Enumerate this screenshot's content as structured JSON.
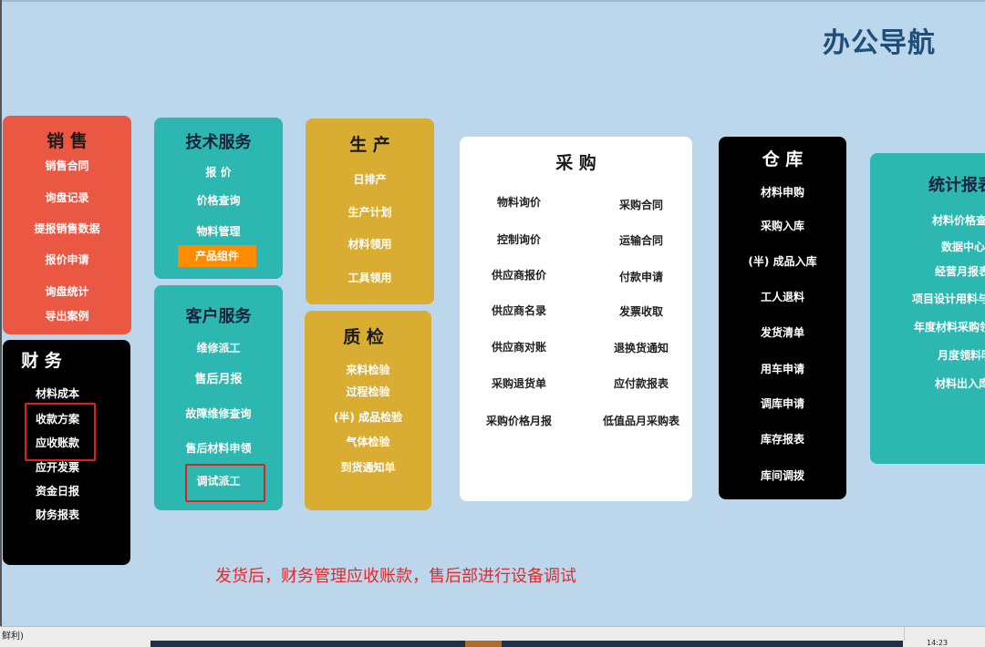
{
  "page_title": "办公导航",
  "sales": {
    "title": "销 售",
    "items": [
      "销售合同",
      "询盘记录",
      "提报销售数据",
      "报价申请",
      "询盘统计",
      "导出案例"
    ]
  },
  "finance": {
    "title": "财 务",
    "items": [
      "材料成本",
      "收款方案",
      "应收账款",
      "应开发票",
      "资金日报",
      "财务报表"
    ]
  },
  "tech_service": {
    "title": "技术服务",
    "items": [
      "报 价",
      "价格查询",
      "物料管理",
      "产品组件"
    ]
  },
  "customer_service": {
    "title": "客户服务",
    "items": [
      "维修派工",
      "售后月报",
      "故障维修查询",
      "售后材料申领",
      "调试派工"
    ]
  },
  "production": {
    "title": "生 产",
    "items": [
      "日排产",
      "生产计划",
      "材料领用",
      "工具领用"
    ]
  },
  "quality": {
    "title": "质 检",
    "items": [
      "来料检验",
      "过程检验",
      "(半) 成品检验",
      "气体检验",
      "到货通知单"
    ]
  },
  "purchase": {
    "title": "采 购",
    "left": [
      "物料询价",
      "控制询价",
      "供应商报价",
      "供应商名录",
      "供应商对账",
      "采购退货单",
      "采购价格月报"
    ],
    "right": [
      "采购合同",
      "运输合同",
      "付款申请",
      "发票收取",
      "退换货通知",
      "应付款报表",
      "低值品月采购表"
    ]
  },
  "warehouse": {
    "title": "仓 库",
    "items": [
      "材料申购",
      "采购入库",
      "(半) 成品入库",
      "工人退料",
      "发货清单",
      "用车申请",
      "调库申请",
      "库存报表",
      "库间调拨"
    ]
  },
  "stats": {
    "title": "统计报表",
    "items": [
      "材料价格查",
      "数据中心",
      "经营月报表",
      "项目设计用料与",
      "年度材料采购领",
      "月度领料明",
      "材料出入库明"
    ]
  },
  "note": "发货后，财务管理应收账款，售后部进行设备调试",
  "status_text": "鲜利)",
  "clock": "14:23",
  "colors": {
    "background": "#bcd6ec",
    "sales": "#ea5743",
    "teal": "#2cb7b1",
    "gold": "#d9ad32",
    "highlight_orange": "#ff8c00",
    "annotation_red": "#e02020"
  }
}
